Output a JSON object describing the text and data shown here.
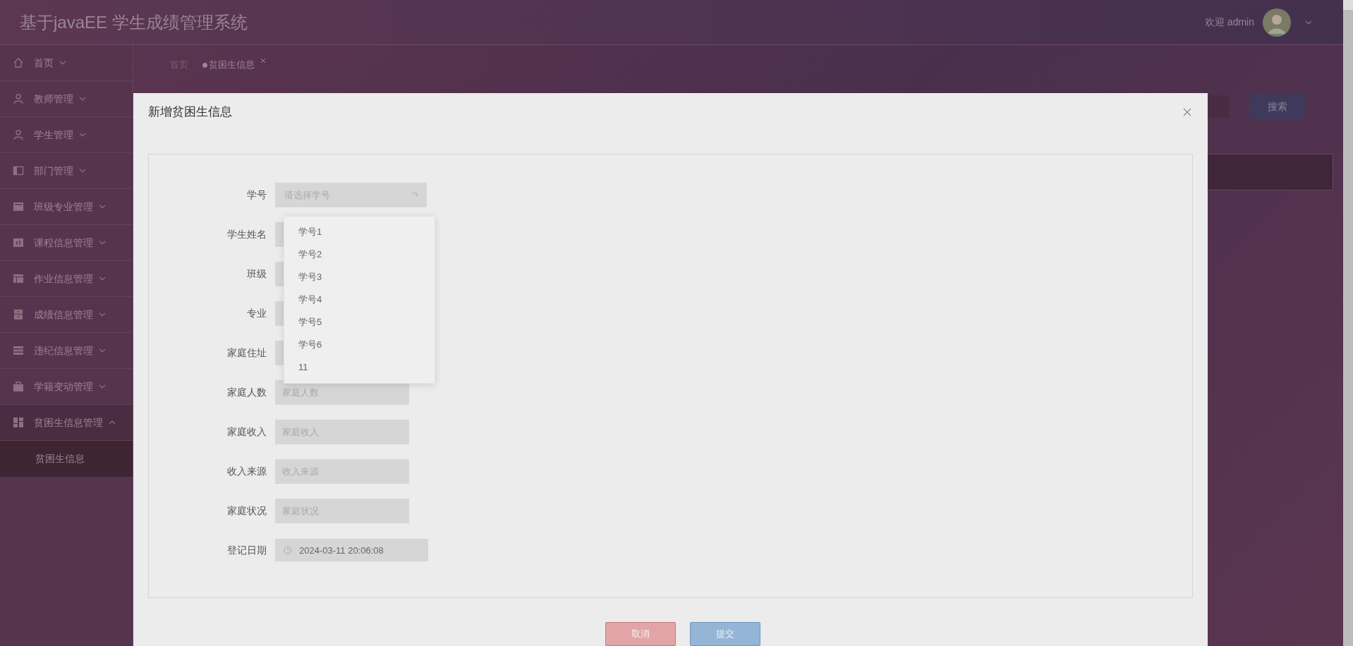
{
  "header": {
    "title": "基于javaEE 学生成绩管理系统",
    "greeting": "欢迎 admin"
  },
  "sidebar": {
    "items": [
      {
        "label": "首页",
        "expanded": false
      },
      {
        "label": "教师管理",
        "expanded": false
      },
      {
        "label": "学生管理",
        "expanded": false
      },
      {
        "label": "部门管理",
        "expanded": false
      },
      {
        "label": "班级专业管理",
        "expanded": false
      },
      {
        "label": "课程信息管理",
        "expanded": false
      },
      {
        "label": "作业信息管理",
        "expanded": false
      },
      {
        "label": "成绩信息管理",
        "expanded": false
      },
      {
        "label": "违纪信息管理",
        "expanded": false
      },
      {
        "label": "学籍变动管理",
        "expanded": false
      },
      {
        "label": "贫困生信息管理",
        "expanded": true,
        "children": [
          {
            "label": "贫困生信息",
            "selected": true
          }
        ]
      }
    ]
  },
  "breadcrumb": [
    {
      "label": "首页",
      "selected": false
    },
    {
      "label": "贫困生信息",
      "selected": true
    }
  ],
  "search_button": "搜索",
  "dialog": {
    "title": "新增贫困生信息",
    "fields": [
      {
        "label": "学号",
        "kind": "select",
        "placeholder": "请选择学号",
        "open": true,
        "options": [
          "学号1",
          "学号2",
          "学号3",
          "学号4",
          "学号5",
          "学号6",
          "11"
        ]
      },
      {
        "label": "学生姓名",
        "kind": "text"
      },
      {
        "label": "班级",
        "kind": "text"
      },
      {
        "label": "专业",
        "kind": "text"
      },
      {
        "label": "家庭住址",
        "kind": "text"
      },
      {
        "label": "家庭人数",
        "kind": "text",
        "placeholder": "家庭人数"
      },
      {
        "label": "家庭收入",
        "kind": "text",
        "placeholder": "家庭收入"
      },
      {
        "label": "收入来源",
        "kind": "text",
        "placeholder": "收入来源"
      },
      {
        "label": "家庭状况",
        "kind": "text",
        "placeholder": "家庭状况"
      },
      {
        "label": "登记日期",
        "kind": "date",
        "value": "2024-03-11 20:06:08"
      }
    ],
    "buttons": [
      {
        "label": "取消",
        "kind": "cancel"
      },
      {
        "label": "提交",
        "kind": "submit"
      }
    ]
  }
}
